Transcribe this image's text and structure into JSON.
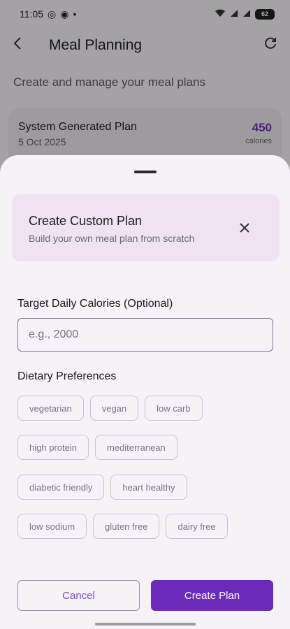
{
  "status_bar": {
    "time": "11:05",
    "icons": [
      "whatsapp-icon",
      "notification-icon",
      "dot-icon"
    ],
    "right_icons": [
      "wifi-icon",
      "signal-icon",
      "signal-icon"
    ],
    "battery": "62"
  },
  "app_bar": {
    "title": "Meal Planning",
    "back_icon": "arrow-left-icon",
    "refresh_icon": "refresh-icon"
  },
  "page": {
    "subtitle": "Create and manage your meal plans",
    "plan_card": {
      "name": "System Generated Plan",
      "date": "5 Oct 2025",
      "calories": "450",
      "calories_unit": "calories"
    }
  },
  "sheet": {
    "header": {
      "title": "Create Custom Plan",
      "subtitle": "Build your own meal plan from scratch",
      "close_icon": "close-icon"
    },
    "calories_field": {
      "label": "Target Daily Calories (Optional)",
      "placeholder": "e.g., 2000",
      "value": ""
    },
    "dietary": {
      "label": "Dietary Preferences",
      "rows": [
        [
          "vegetarian",
          "vegan",
          "low carb"
        ],
        [
          "high protein",
          "mediterranean"
        ],
        [
          "diabetic friendly",
          "heart healthy"
        ],
        [
          "low sodium",
          "gluten free",
          "dairy free"
        ]
      ]
    },
    "buttons": {
      "cancel": "Cancel",
      "create": "Create Plan"
    }
  },
  "colors": {
    "accent": "#6b2bb8",
    "sheet_bg": "#f7f1f8",
    "header_card_bg": "#efe3f3"
  }
}
